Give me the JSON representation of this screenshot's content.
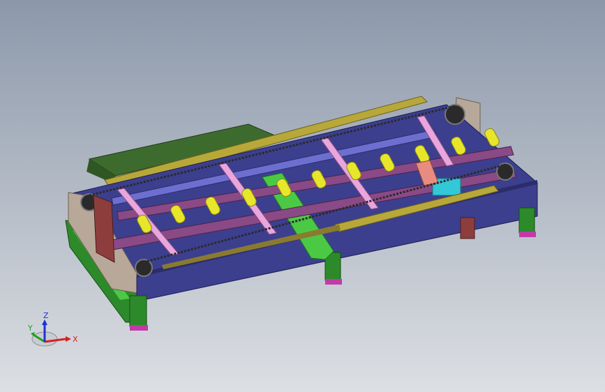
{
  "viewport": {
    "background_top": "#8c98aa",
    "background_bottom": "#dcdfe3"
  },
  "model": {
    "colors": {
      "frame_blue": "#3c3f8e",
      "frame_blue_dark": "#2b2d6a",
      "roller_yellow": "#e8e62a",
      "crossbar_pink": "#e8a6dc",
      "crossbar_purple": "#8a4a86",
      "leg_green": "#2d8a2a",
      "leg_green_light": "#4cc944",
      "guide_olive": "#b8a83a",
      "chute_green": "#3d6b2e",
      "plate_maroon": "#8e3d3d",
      "foot_magenta": "#c23aa8",
      "end_plate_tan": "#b8a89a",
      "motor_cyan": "#33c8d8",
      "bracket_salmon": "#e88c80",
      "chain_black": "#2a2a2a"
    }
  },
  "triad": {
    "x_label": "X",
    "y_label": "Y",
    "z_label": "Z",
    "x_color": "#d82020",
    "y_color": "#20a020",
    "z_color": "#2030d0"
  }
}
